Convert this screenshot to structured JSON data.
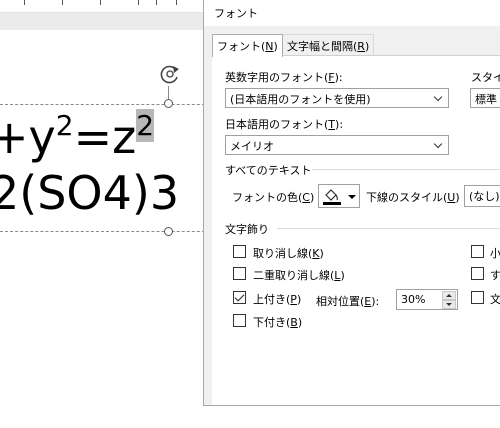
{
  "slide": {
    "equation_line1_base": "+y",
    "equation_line1_exp1": "2",
    "equation_line1_mid": "=z",
    "equation_line1_exp2": "2",
    "equation_line2": "2(SO4)3"
  },
  "dialog": {
    "title": "フォント",
    "tabs": [
      {
        "label": "フォント(",
        "key": "N",
        "suffix": ")",
        "active": true
      },
      {
        "label": "文字幅と間隔(",
        "key": "R",
        "suffix": ")",
        "active": false
      }
    ],
    "latin_font_label": "英数字用のフォント(",
    "latin_font_key": "F",
    "latin_font_suffix": "):",
    "latin_font_value": "(日本語用のフォントを使用)",
    "style_label": "スタイル",
    "style_value": "標準",
    "japanese_font_label": "日本語用のフォント(",
    "japanese_font_key": "T",
    "japanese_font_suffix": "):",
    "japanese_font_value": "メイリオ",
    "all_text_section": "すべてのテキスト",
    "font_color_label": "フォントの色(",
    "font_color_key": "C",
    "font_color_suffix": ")",
    "font_color_value": "#000000",
    "underline_style_label": "下線のスタイル(",
    "underline_style_key": "U",
    "underline_style_suffix": ")",
    "underline_style_value": "(なし)",
    "effects_section": "文字飾り",
    "effects_left": [
      {
        "label": "取り消し線(",
        "key": "K",
        "suffix": ")",
        "checked": false
      },
      {
        "label": "二重取り消し線(",
        "key": "L",
        "suffix": ")",
        "checked": false
      },
      {
        "label": "上付き(",
        "key": "P",
        "suffix": ")",
        "checked": true
      },
      {
        "label": "下付き(",
        "key": "B",
        "suffix": ")",
        "checked": false
      }
    ],
    "offset_label": "相対位置(",
    "offset_key": "E",
    "offset_suffix": "):",
    "offset_value": "30%",
    "effects_right": [
      {
        "label": "小",
        "checked": false
      },
      {
        "label": "す",
        "checked": false
      },
      {
        "label": "文",
        "checked": false
      }
    ]
  }
}
